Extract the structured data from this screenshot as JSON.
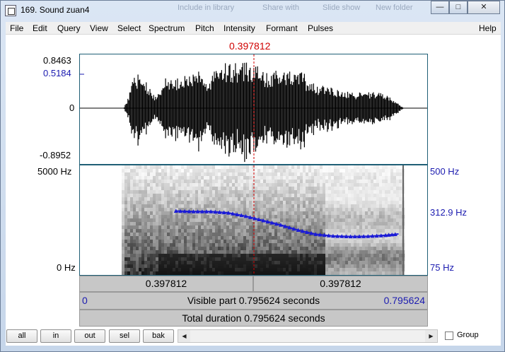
{
  "window": {
    "title": "169. Sound zuan4",
    "ghost_items": [
      "Include in library",
      "Share with",
      "Slide show",
      "New folder"
    ]
  },
  "menu": [
    "File",
    "Edit",
    "Query",
    "View",
    "Select",
    "Spectrum",
    "Pitch",
    "Intensity",
    "Formant",
    "Pulses",
    "Help"
  ],
  "cursor": {
    "time": "0.397812"
  },
  "waveform": {
    "max": "0.8463",
    "marker": "0.5184",
    "zero": "0",
    "min": "-0.8952"
  },
  "spectrogram": {
    "freq_top": "5000 Hz",
    "freq_bottom": "0 Hz",
    "pitch_top": "500 Hz",
    "pitch_mid": "312.9 Hz",
    "pitch_bottom": "75 Hz"
  },
  "pitch_contour": {
    "unit": "Hz",
    "ylim": [
      75,
      500
    ],
    "times": [
      0.22,
      0.26,
      0.3,
      0.34,
      0.38,
      0.42,
      0.46,
      0.5,
      0.54,
      0.58,
      0.62,
      0.66,
      0.7,
      0.73
    ],
    "values": [
      323,
      321,
      321,
      316,
      303,
      286,
      269,
      249,
      233,
      226,
      224,
      225,
      229,
      234
    ]
  },
  "status": {
    "left_segment": "0.397812",
    "right_segment": "0.397812",
    "visible_start": "0",
    "visible_text": "Visible part 0.795624 seconds",
    "visible_end": "0.795624",
    "total_text": "Total duration 0.795624 seconds"
  },
  "buttons": {
    "all": "all",
    "in": "in",
    "out": "out",
    "sel": "sel",
    "bak": "bak"
  },
  "group_label": "Group"
}
